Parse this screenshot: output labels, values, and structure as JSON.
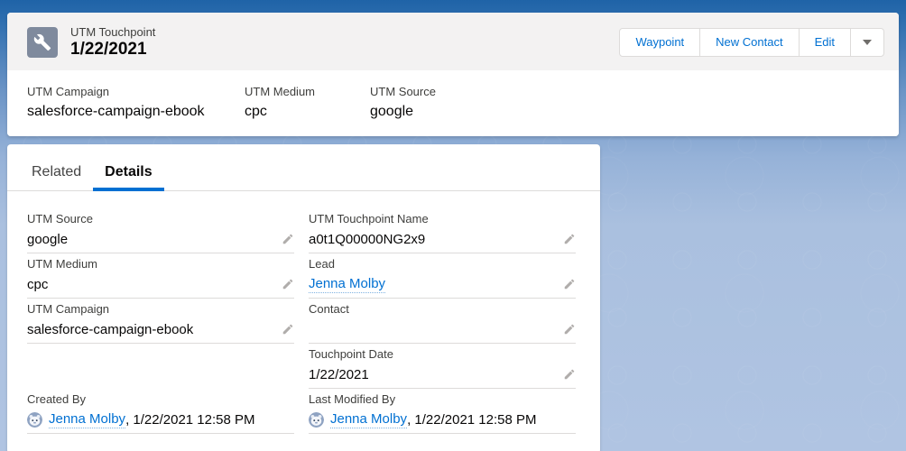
{
  "header": {
    "object_label": "UTM Touchpoint",
    "record_title": "1/22/2021",
    "record_icon": "wrench-icon",
    "actions": [
      {
        "label": "Waypoint"
      },
      {
        "label": "New Contact"
      },
      {
        "label": "Edit"
      }
    ],
    "more_actions_icon": "chevron-down-icon"
  },
  "highlights": [
    {
      "label": "UTM Campaign",
      "value": "salesforce-campaign-ebook"
    },
    {
      "label": "UTM Medium",
      "value": "cpc"
    },
    {
      "label": "UTM Source",
      "value": "google"
    }
  ],
  "tabs": [
    {
      "label": "Related",
      "active": false
    },
    {
      "label": "Details",
      "active": true
    }
  ],
  "details": {
    "fields": [
      {
        "label": "UTM Source",
        "value": "google"
      },
      {
        "label": "UTM Touchpoint Name",
        "value": "a0t1Q00000NG2x9"
      },
      {
        "label": "UTM Medium",
        "value": "cpc"
      },
      {
        "label": "Lead",
        "value": "Jenna Molby"
      },
      {
        "label": "UTM Campaign",
        "value": "salesforce-campaign-ebook"
      },
      {
        "label": "Contact",
        "value": ""
      },
      {
        "label": "Touchpoint Date",
        "value": "1/22/2021"
      },
      {
        "label": "Created By",
        "user": "Jenna Molby",
        "datetime": ", 1/22/2021 12:58 PM"
      },
      {
        "label": "Last Modified By",
        "user": "Jenna Molby",
        "datetime": ", 1/22/2021 12:58 PM"
      }
    ],
    "edit_icon": "pencil-icon",
    "user_icon": "avatar"
  },
  "colors": {
    "brand_blue": "#0070d2",
    "record_icon_bg": "#7f8a9d",
    "header_band_bg": "#f3f2f2",
    "page_bg_top": "#1f63a7",
    "page_bg_bottom": "#b0c4e2",
    "divider": "#dddbda",
    "label_gray": "#3e3e3c",
    "value_dark": "#080707",
    "pencil_gray": "#b0adab"
  }
}
